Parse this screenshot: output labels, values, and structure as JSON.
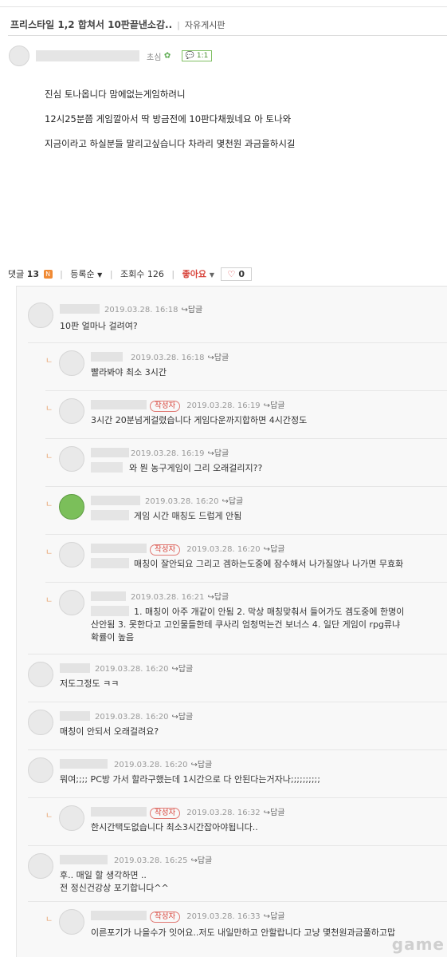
{
  "post": {
    "title": "프리스타일 1,2 합쳐서 10판끝낸소감..",
    "board": "자유게시판",
    "author_level": "초심",
    "comment_badge": "1:1",
    "body": [
      "진심 토나옵니다 맘에없는게임하려니",
      "12시25분쯤 게임깔아서 딱 방금전에 10판다채웠네요 아 토나와",
      "지금이라고 하실분들 말리고싶습니다 차라리 몇천원 과금을하시길"
    ]
  },
  "bar": {
    "comments_label": "댓글",
    "comments_count": "13",
    "new_badge": "N",
    "sort_label": "등록순",
    "views_label": "조회수",
    "views_count": "126",
    "like_label": "좋아요",
    "like_count": "0"
  },
  "labels": {
    "reply": "답글",
    "author": "작성자",
    "watermark": "game"
  },
  "comments": [
    {
      "time": "2019.03.28. 16:18",
      "text": "10판 얼마나 걸려여?"
    },
    {
      "time": "2019.03.28. 16:18",
      "text": "빨라봐야 최소 3시간"
    },
    {
      "time": "2019.03.28. 16:19",
      "text": "3시간 20분넘게걸렸습니다 게임다운까지합하면 4시간정도"
    },
    {
      "time": "2019.03.28. 16:19",
      "text": "와 뭔 농구게임이 그리 오래걸리지??"
    },
    {
      "time": "2019.03.28. 16:20",
      "text": "게임 시간 매칭도 드럽게 안됨"
    },
    {
      "time": "2019.03.28. 16:20",
      "text": "매칭이 잘안되요 그리고 겜하는도중에 잠수해서 나가질않나 나가면 무효화"
    },
    {
      "time": "2019.03.28. 16:21",
      "text_lines": [
        "1. 매칭이 아주 개같이 안됨 2. 막상 매칭맞춰서 들어가도 겜도중에 한명이",
        "산안됨 3. 못한다고 고인물들한테 쿠사리 엄청먹는건 보너스 4. 일단 게임이 rpg류냐",
        "확률이 높음"
      ]
    },
    {
      "time": "2019.03.28. 16:20",
      "text": "저도그정도 ㅋㅋ"
    },
    {
      "time": "2019.03.28. 16:20",
      "text": "매칭이 안되서 오래걸려요?"
    },
    {
      "time": "2019.03.28. 16:20",
      "text": "뭐여;;;; PC방 가서 할라구했는데 1시간으로 다 안된다는거자나;;;;;;;;;;"
    },
    {
      "time": "2019.03.28. 16:32",
      "text": "한시간택도없습니다 최소3시간잡아야됩니다.."
    },
    {
      "time": "2019.03.28. 16:25",
      "text_lines": [
        "후.. 매일 할 생각하면 ..",
        "전 정신건강상 포기합니다^^"
      ]
    },
    {
      "time": "2019.03.28. 16:33",
      "text": "이른포기가 나을수가 잇어요..저도 내일만하고 안할랍니다 고냥 몇천원과금풀하고맙"
    }
  ]
}
